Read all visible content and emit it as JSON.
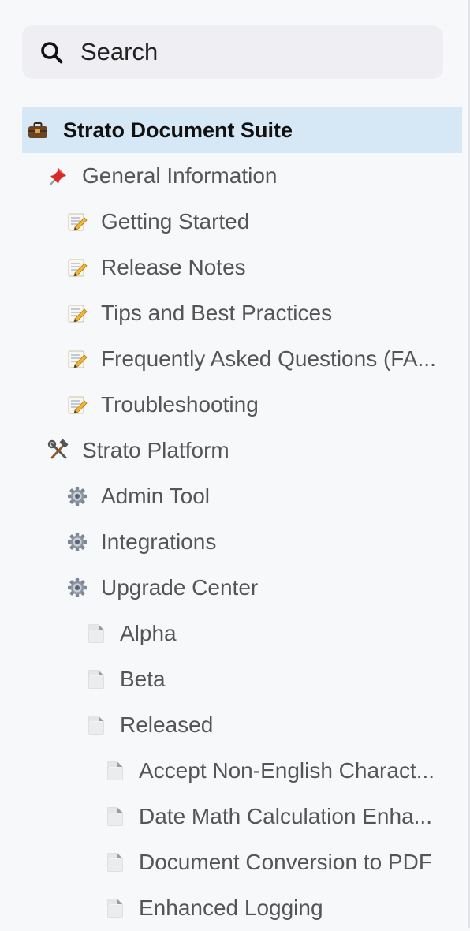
{
  "search": {
    "placeholder": "Search"
  },
  "tree": {
    "items": [
      {
        "label": "Strato Document Suite",
        "icon": "briefcase-icon",
        "level": 0,
        "selected": true
      },
      {
        "label": "General Information",
        "icon": "pushpin-icon",
        "level": 1
      },
      {
        "label": "Getting Started",
        "icon": "memo-icon",
        "level": 2
      },
      {
        "label": "Release Notes",
        "icon": "memo-icon",
        "level": 2
      },
      {
        "label": "Tips and Best Practices",
        "icon": "memo-icon",
        "level": 2
      },
      {
        "label": "Frequently Asked Questions (FA...",
        "icon": "memo-icon",
        "level": 2
      },
      {
        "label": "Troubleshooting",
        "icon": "memo-icon",
        "level": 2
      },
      {
        "label": "Strato Platform",
        "icon": "hammer-wrench-icon",
        "level": 1
      },
      {
        "label": "Admin Tool",
        "icon": "gear-icon",
        "level": 2
      },
      {
        "label": "Integrations",
        "icon": "gear-icon",
        "level": 2
      },
      {
        "label": "Upgrade Center",
        "icon": "gear-icon",
        "level": 2
      },
      {
        "label": "Alpha",
        "icon": "page-icon",
        "level": 3
      },
      {
        "label": "Beta",
        "icon": "page-icon",
        "level": 3
      },
      {
        "label": "Released",
        "icon": "page-icon",
        "level": 3
      },
      {
        "label": "Accept Non-English Charact...",
        "icon": "page-icon",
        "level": 4
      },
      {
        "label": "Date Math Calculation Enha...",
        "icon": "page-icon",
        "level": 4
      },
      {
        "label": "Document Conversion to PDF",
        "icon": "page-icon",
        "level": 4
      },
      {
        "label": "Enhanced Logging",
        "icon": "page-icon",
        "level": 4
      }
    ]
  },
  "colors": {
    "background": "#f7f8fa",
    "search_background": "#efeef3",
    "selected_background": "#d6e7f5",
    "text": "#555555",
    "selected_text": "#111111"
  }
}
